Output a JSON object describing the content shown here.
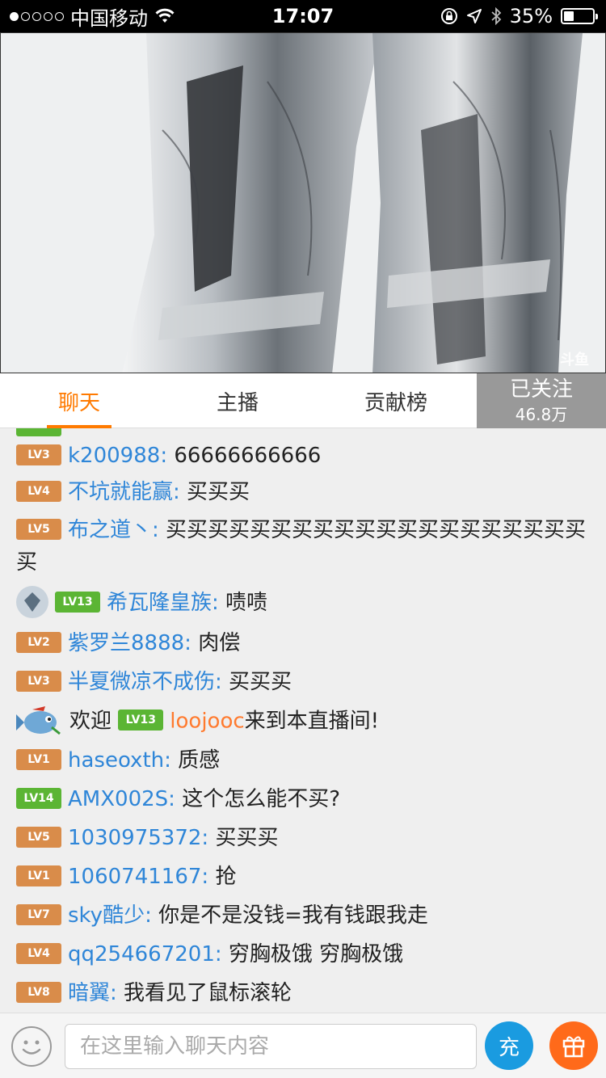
{
  "status_bar": {
    "carrier": "中国移动",
    "time": "17:07",
    "battery": "35%",
    "battery_level": 0.35,
    "signal_bars_filled": 1,
    "signal_bars_total": 5
  },
  "video": {
    "watermark": "斗鱼"
  },
  "tabs": {
    "chat": "聊天",
    "anchor": "主播",
    "contribution": "贡献榜"
  },
  "follow": {
    "label": "已关注",
    "count": "46.8万"
  },
  "chat": {
    "messages": [
      {
        "level": "LV3",
        "user": "k200988",
        "text": "66666666666"
      },
      {
        "level": "LV4",
        "user": "不坑就能赢",
        "text": "买买买"
      },
      {
        "level": "LV5",
        "user": "布之道丶",
        "text": "买买买买买买买买买买买买买买买买买买买买买"
      },
      {
        "level": "LV13",
        "user": "希瓦隆皇族",
        "text": "啧啧"
      },
      {
        "level": "LV2",
        "user": "紫罗兰8888",
        "text": "肉偿"
      },
      {
        "level": "LV3",
        "user": "半夏微凉不成伤",
        "text": "买买买"
      },
      {
        "prefix": "欢迎",
        "level": "LV13",
        "user": "loojooc",
        "suffix": "来到本直播间!"
      },
      {
        "level": "LV1",
        "user": "haseoxth",
        "text": "质感"
      },
      {
        "level": "LV14",
        "user": "AMX002S",
        "text": "这个怎么能不买?"
      },
      {
        "level": "LV5",
        "user": "1030975372",
        "text": "买买买"
      },
      {
        "level": "LV1",
        "user": "1060741167",
        "text": "抢"
      },
      {
        "level": "LV7",
        "user": "sky酷少",
        "text": "你是不是没钱=我有钱跟我走"
      },
      {
        "level": "LV4",
        "user": "qq254667201",
        "text": "穷胸极饿 穷胸极饿"
      },
      {
        "level": "LV8",
        "user": "暗翼",
        "text": "我看见了鼠标滚轮"
      }
    ]
  },
  "input_bar": {
    "placeholder": "在这里输入聊天内容",
    "recharge_label": "充"
  },
  "colors": {
    "accent": "#ff7a00",
    "nick": "#2f86d8",
    "level_orange": "#d98c4a",
    "level_green": "#5bb534",
    "recharge": "#1a9be0",
    "gift": "#ff6a1a"
  }
}
